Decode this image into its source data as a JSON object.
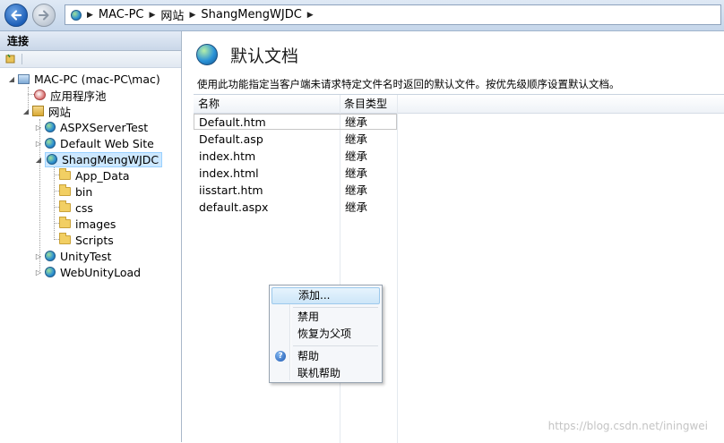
{
  "breadcrumb": [
    "MAC-PC",
    "网站",
    "ShangMengWJDC"
  ],
  "connections": {
    "header": "连接",
    "tree": {
      "server": "MAC-PC (mac-PC\\mac)",
      "app_pools": "应用程序池",
      "sites": "网站",
      "site_list": [
        "ASPXServerTest",
        "Default Web Site",
        "ShangMengWJDC",
        "UnityTest",
        "WebUnityLoad"
      ],
      "selected_site": "ShangMengWJDC",
      "folders": [
        "App_Data",
        "bin",
        "css",
        "images",
        "Scripts"
      ]
    }
  },
  "main": {
    "title": "默认文档",
    "description": "使用此功能指定当客户端未请求特定文件名时返回的默认文件。按优先级顺序设置默认文档。",
    "columns": [
      "名称",
      "条目类型"
    ],
    "rows": [
      {
        "name": "Default.htm",
        "type": "继承"
      },
      {
        "name": "Default.asp",
        "type": "继承"
      },
      {
        "name": "index.htm",
        "type": "继承"
      },
      {
        "name": "index.html",
        "type": "继承"
      },
      {
        "name": "iisstart.htm",
        "type": "继承"
      },
      {
        "name": "default.aspx",
        "type": "继承"
      }
    ]
  },
  "context_menu": {
    "add": "添加...",
    "disable": "禁用",
    "revert": "恢复为父项",
    "help": "帮助",
    "online_help": "联机帮助"
  },
  "watermark": "https://blog.csdn.net/iningwei"
}
